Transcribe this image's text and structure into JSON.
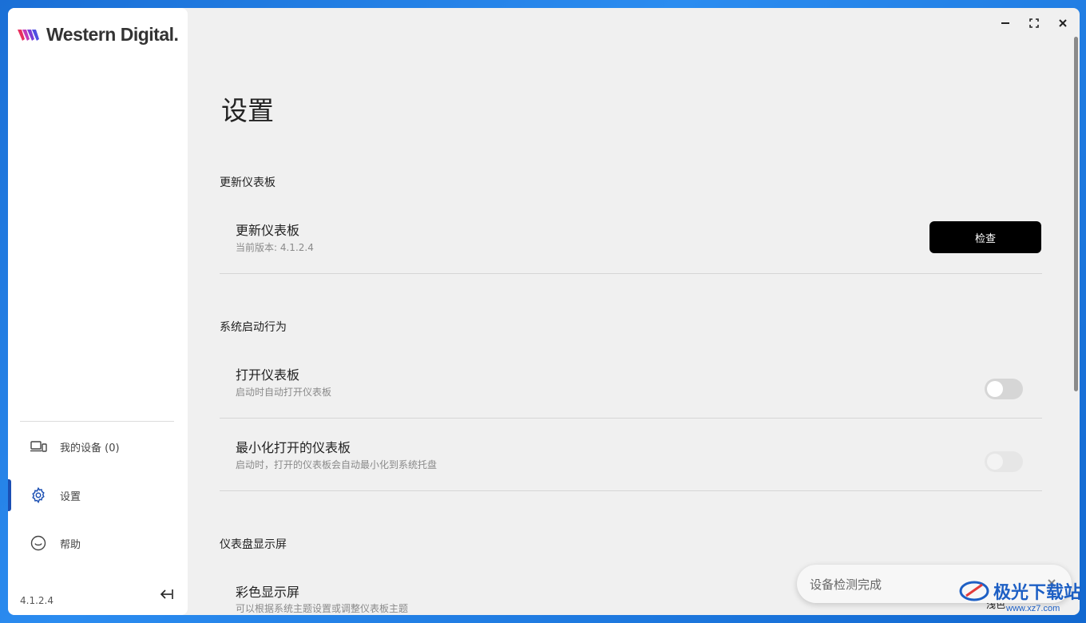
{
  "sidebar": {
    "logo_text": "Western Digital.",
    "items": [
      {
        "label": "我的设备 (0)",
        "icon": "devices-icon"
      },
      {
        "label": "设置",
        "icon": "gear-icon"
      },
      {
        "label": "帮助",
        "icon": "help-icon"
      }
    ],
    "version": "4.1.2.4"
  },
  "main": {
    "title": "设置",
    "sections": [
      {
        "title": "更新仪表板",
        "rows": [
          {
            "title": "更新仪表板",
            "subtitle": "当前版本: 4.1.2.4",
            "button_label": "检查"
          }
        ]
      },
      {
        "title": "系统启动行为",
        "rows": [
          {
            "title": "打开仪表板",
            "subtitle": "启动时自动打开仪表板",
            "toggle": false
          },
          {
            "title": "最小化打开的仪表板",
            "subtitle": "启动时，打开的仪表板会自动最小化到系统托盘",
            "toggle": false,
            "disabled": true
          }
        ]
      },
      {
        "title": "仪表盘显示屏",
        "rows": [
          {
            "title": "彩色显示屏",
            "subtitle": "可以根据系统主题设置或调整仪表板主题",
            "value": "浅色"
          }
        ]
      }
    ]
  },
  "toast": {
    "text": "设备检测完成"
  },
  "watermark": {
    "text": "极光下载站",
    "url": "www.xz7.com"
  },
  "colors": {
    "accent": "#1b4fb3",
    "button_bg": "#000000",
    "background": "#f0f0f0"
  }
}
